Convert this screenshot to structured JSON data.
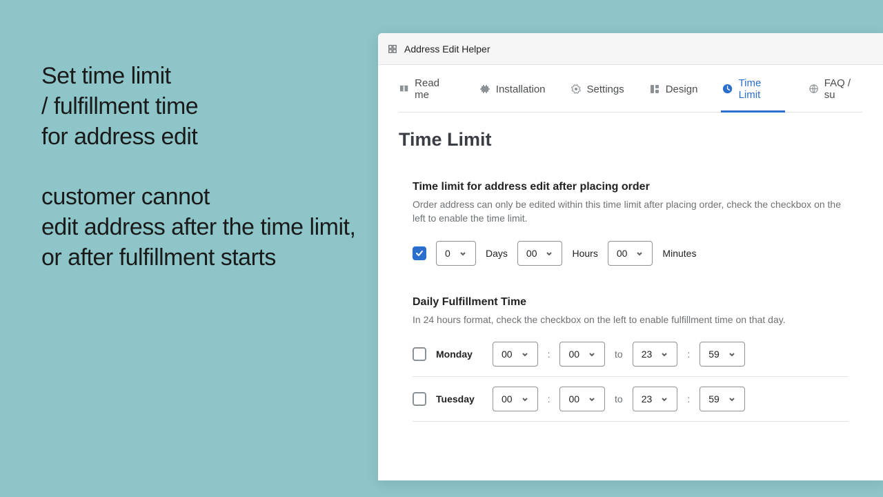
{
  "marketing": {
    "line1": "Set time limit",
    "line2": "/ fulfillment time",
    "line3": "for address edit",
    "line4": "customer cannot",
    "line5": "edit address after the time limit,",
    "line6": "or after fulfillment starts"
  },
  "window": {
    "title": "Address Edit Helper"
  },
  "tabs": [
    {
      "label": "Read me",
      "icon": "book-icon",
      "active": false
    },
    {
      "label": "Installation",
      "icon": "puzzle-icon",
      "active": false
    },
    {
      "label": "Settings",
      "icon": "gear-icon",
      "active": false
    },
    {
      "label": "Design",
      "icon": "design-icon",
      "active": false
    },
    {
      "label": "Time Limit",
      "icon": "clock-icon",
      "active": true
    },
    {
      "label": "FAQ / su",
      "icon": "globe-icon",
      "active": false
    }
  ],
  "page": {
    "title": "Time Limit"
  },
  "timelimit": {
    "title": "Time limit for address edit after placing order",
    "desc": "Order address can only be edited within this time limit after placing order, check the checkbox on the left to enable the time limit.",
    "enabled": true,
    "days": "0",
    "days_label": "Days",
    "hours": "00",
    "hours_label": "Hours",
    "minutes": "00",
    "minutes_label": "Minutes"
  },
  "fulfillment": {
    "title": "Daily Fulfillment Time",
    "desc": "In 24 hours format, check the checkbox on the left to enable fulfillment time on that day.",
    "to_label": "to",
    "days": [
      {
        "name": "Monday",
        "enabled": false,
        "start_h": "00",
        "start_m": "00",
        "end_h": "23",
        "end_m": "59"
      },
      {
        "name": "Tuesday",
        "enabled": false,
        "start_h": "00",
        "start_m": "00",
        "end_h": "23",
        "end_m": "59"
      }
    ]
  }
}
